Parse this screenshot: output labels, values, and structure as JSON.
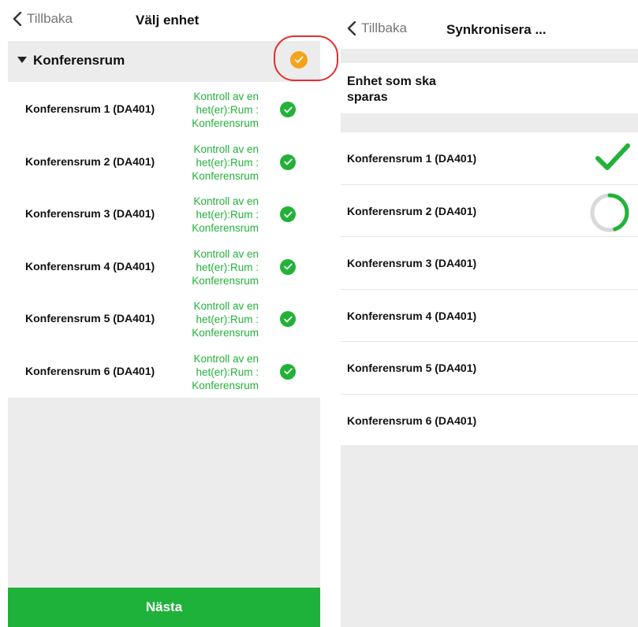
{
  "left_screen": {
    "back_label": "Tillbaka",
    "title": "Välj enhet",
    "group": {
      "label": "Konferensrum",
      "selection_color": "#f7a21b"
    },
    "items": [
      {
        "name": "Konferensrum 1 (DA401)",
        "status": "Kontroll av en het(er):Rum : Konferensrum",
        "status_icon": "check-circle-icon"
      },
      {
        "name": "Konferensrum 2 (DA401)",
        "status": "Kontroll av en het(er):Rum : Konferensrum",
        "status_icon": "check-circle-icon"
      },
      {
        "name": "Konferensrum 3 (DA401)",
        "status": "Kontroll av en het(er):Rum : Konferensrum",
        "status_icon": "check-circle-icon"
      },
      {
        "name": "Konferensrum 4 (DA401)",
        "status": "Kontroll av en het(er):Rum : Konferensrum",
        "status_icon": "check-circle-icon"
      },
      {
        "name": "Konferensrum 5 (DA401)",
        "status": "Kontroll av en het(er):Rum : Konferensrum",
        "status_icon": "check-circle-icon"
      },
      {
        "name": "Konferensrum 6 (DA401)",
        "status": "Kontroll av en het(er):Rum : Konferensrum",
        "status_icon": "check-circle-icon"
      }
    ],
    "next_button": "Nästa",
    "accent_color": "#22b23a"
  },
  "right_screen": {
    "back_label": "Tillbaka",
    "title": "Synkronisera ...",
    "section_label": "Enhet som ska sparas",
    "items": [
      {
        "name": "Konferensrum 1 (DA401)",
        "state": "done",
        "icon": "checkmark-icon"
      },
      {
        "name": "Konferensrum 2 (DA401)",
        "state": "in-progress",
        "icon": "progress-spinner-icon",
        "progress": 0.45
      },
      {
        "name": "Konferensrum 3 (DA401)",
        "state": "pending"
      },
      {
        "name": "Konferensrum 4 (DA401)",
        "state": "pending"
      },
      {
        "name": "Konferensrum 5 (DA401)",
        "state": "pending"
      },
      {
        "name": "Konferensrum 6 (DA401)",
        "state": "pending"
      }
    ]
  }
}
